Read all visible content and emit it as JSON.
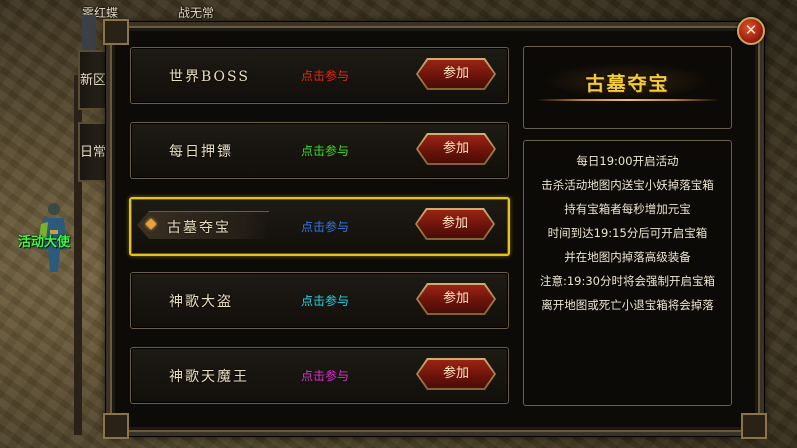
{
  "world": {
    "npc_labels": [
      "零红蝶",
      "战无常"
    ],
    "npc_guide": "活动大使"
  },
  "side_tabs": [
    {
      "label": "新区"
    },
    {
      "label": "日常"
    }
  ],
  "activities": [
    {
      "name": "世界BOSS",
      "join_text": "点击参与",
      "join_color": "#e02a18",
      "button": "参加",
      "selected": false
    },
    {
      "name": "每日押镖",
      "join_text": "点击参与",
      "join_color": "#38e020",
      "button": "参加",
      "selected": false
    },
    {
      "name": "古墓夺宝",
      "join_text": "点击参与",
      "join_color": "#2a78f0",
      "button": "参加",
      "selected": true
    },
    {
      "name": "神歌大盗",
      "join_text": "点击参与",
      "join_color": "#1ed8e8",
      "button": "参加",
      "selected": false
    },
    {
      "name": "神歌天魔王",
      "join_text": "点击参与",
      "join_color": "#d830d0",
      "button": "参加",
      "selected": false
    }
  ],
  "detail": {
    "title": "古墓夺宝",
    "lines": [
      "每日19:00开启活动",
      "击杀活动地图内送宝小妖掉落宝箱",
      "持有宝箱者每秒增加元宝",
      "时间到达19:15分后可开启宝箱",
      "并在地图内掉落高级装备",
      "注意:19:30分时将会强制开启宝箱",
      "离开地图或死亡小退宝箱将会掉落"
    ]
  },
  "close_icon": "close-icon"
}
